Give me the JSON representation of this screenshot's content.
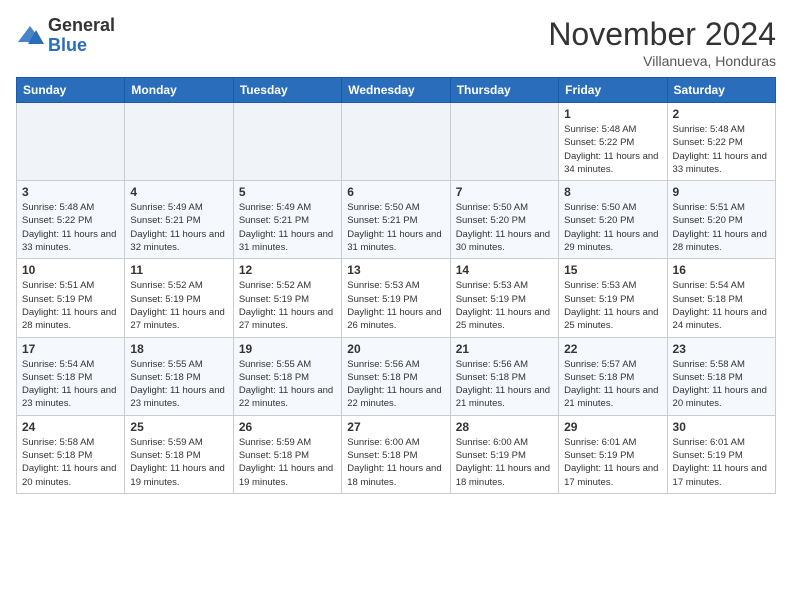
{
  "logo": {
    "general": "General",
    "blue": "Blue"
  },
  "header": {
    "month": "November 2024",
    "location": "Villanueva, Honduras"
  },
  "weekdays": [
    "Sunday",
    "Monday",
    "Tuesday",
    "Wednesday",
    "Thursday",
    "Friday",
    "Saturday"
  ],
  "weeks": [
    [
      {
        "day": "",
        "sunrise": "",
        "sunset": "",
        "daylight": ""
      },
      {
        "day": "",
        "sunrise": "",
        "sunset": "",
        "daylight": ""
      },
      {
        "day": "",
        "sunrise": "",
        "sunset": "",
        "daylight": ""
      },
      {
        "day": "",
        "sunrise": "",
        "sunset": "",
        "daylight": ""
      },
      {
        "day": "",
        "sunrise": "",
        "sunset": "",
        "daylight": ""
      },
      {
        "day": "1",
        "sunrise": "Sunrise: 5:48 AM",
        "sunset": "Sunset: 5:22 PM",
        "daylight": "Daylight: 11 hours and 34 minutes."
      },
      {
        "day": "2",
        "sunrise": "Sunrise: 5:48 AM",
        "sunset": "Sunset: 5:22 PM",
        "daylight": "Daylight: 11 hours and 33 minutes."
      }
    ],
    [
      {
        "day": "3",
        "sunrise": "Sunrise: 5:48 AM",
        "sunset": "Sunset: 5:22 PM",
        "daylight": "Daylight: 11 hours and 33 minutes."
      },
      {
        "day": "4",
        "sunrise": "Sunrise: 5:49 AM",
        "sunset": "Sunset: 5:21 PM",
        "daylight": "Daylight: 11 hours and 32 minutes."
      },
      {
        "day": "5",
        "sunrise": "Sunrise: 5:49 AM",
        "sunset": "Sunset: 5:21 PM",
        "daylight": "Daylight: 11 hours and 31 minutes."
      },
      {
        "day": "6",
        "sunrise": "Sunrise: 5:50 AM",
        "sunset": "Sunset: 5:21 PM",
        "daylight": "Daylight: 11 hours and 31 minutes."
      },
      {
        "day": "7",
        "sunrise": "Sunrise: 5:50 AM",
        "sunset": "Sunset: 5:20 PM",
        "daylight": "Daylight: 11 hours and 30 minutes."
      },
      {
        "day": "8",
        "sunrise": "Sunrise: 5:50 AM",
        "sunset": "Sunset: 5:20 PM",
        "daylight": "Daylight: 11 hours and 29 minutes."
      },
      {
        "day": "9",
        "sunrise": "Sunrise: 5:51 AM",
        "sunset": "Sunset: 5:20 PM",
        "daylight": "Daylight: 11 hours and 28 minutes."
      }
    ],
    [
      {
        "day": "10",
        "sunrise": "Sunrise: 5:51 AM",
        "sunset": "Sunset: 5:19 PM",
        "daylight": "Daylight: 11 hours and 28 minutes."
      },
      {
        "day": "11",
        "sunrise": "Sunrise: 5:52 AM",
        "sunset": "Sunset: 5:19 PM",
        "daylight": "Daylight: 11 hours and 27 minutes."
      },
      {
        "day": "12",
        "sunrise": "Sunrise: 5:52 AM",
        "sunset": "Sunset: 5:19 PM",
        "daylight": "Daylight: 11 hours and 27 minutes."
      },
      {
        "day": "13",
        "sunrise": "Sunrise: 5:53 AM",
        "sunset": "Sunset: 5:19 PM",
        "daylight": "Daylight: 11 hours and 26 minutes."
      },
      {
        "day": "14",
        "sunrise": "Sunrise: 5:53 AM",
        "sunset": "Sunset: 5:19 PM",
        "daylight": "Daylight: 11 hours and 25 minutes."
      },
      {
        "day": "15",
        "sunrise": "Sunrise: 5:53 AM",
        "sunset": "Sunset: 5:19 PM",
        "daylight": "Daylight: 11 hours and 25 minutes."
      },
      {
        "day": "16",
        "sunrise": "Sunrise: 5:54 AM",
        "sunset": "Sunset: 5:18 PM",
        "daylight": "Daylight: 11 hours and 24 minutes."
      }
    ],
    [
      {
        "day": "17",
        "sunrise": "Sunrise: 5:54 AM",
        "sunset": "Sunset: 5:18 PM",
        "daylight": "Daylight: 11 hours and 23 minutes."
      },
      {
        "day": "18",
        "sunrise": "Sunrise: 5:55 AM",
        "sunset": "Sunset: 5:18 PM",
        "daylight": "Daylight: 11 hours and 23 minutes."
      },
      {
        "day": "19",
        "sunrise": "Sunrise: 5:55 AM",
        "sunset": "Sunset: 5:18 PM",
        "daylight": "Daylight: 11 hours and 22 minutes."
      },
      {
        "day": "20",
        "sunrise": "Sunrise: 5:56 AM",
        "sunset": "Sunset: 5:18 PM",
        "daylight": "Daylight: 11 hours and 22 minutes."
      },
      {
        "day": "21",
        "sunrise": "Sunrise: 5:56 AM",
        "sunset": "Sunset: 5:18 PM",
        "daylight": "Daylight: 11 hours and 21 minutes."
      },
      {
        "day": "22",
        "sunrise": "Sunrise: 5:57 AM",
        "sunset": "Sunset: 5:18 PM",
        "daylight": "Daylight: 11 hours and 21 minutes."
      },
      {
        "day": "23",
        "sunrise": "Sunrise: 5:58 AM",
        "sunset": "Sunset: 5:18 PM",
        "daylight": "Daylight: 11 hours and 20 minutes."
      }
    ],
    [
      {
        "day": "24",
        "sunrise": "Sunrise: 5:58 AM",
        "sunset": "Sunset: 5:18 PM",
        "daylight": "Daylight: 11 hours and 20 minutes."
      },
      {
        "day": "25",
        "sunrise": "Sunrise: 5:59 AM",
        "sunset": "Sunset: 5:18 PM",
        "daylight": "Daylight: 11 hours and 19 minutes."
      },
      {
        "day": "26",
        "sunrise": "Sunrise: 5:59 AM",
        "sunset": "Sunset: 5:18 PM",
        "daylight": "Daylight: 11 hours and 19 minutes."
      },
      {
        "day": "27",
        "sunrise": "Sunrise: 6:00 AM",
        "sunset": "Sunset: 5:18 PM",
        "daylight": "Daylight: 11 hours and 18 minutes."
      },
      {
        "day": "28",
        "sunrise": "Sunrise: 6:00 AM",
        "sunset": "Sunset: 5:19 PM",
        "daylight": "Daylight: 11 hours and 18 minutes."
      },
      {
        "day": "29",
        "sunrise": "Sunrise: 6:01 AM",
        "sunset": "Sunset: 5:19 PM",
        "daylight": "Daylight: 11 hours and 17 minutes."
      },
      {
        "day": "30",
        "sunrise": "Sunrise: 6:01 AM",
        "sunset": "Sunset: 5:19 PM",
        "daylight": "Daylight: 11 hours and 17 minutes."
      }
    ]
  ]
}
